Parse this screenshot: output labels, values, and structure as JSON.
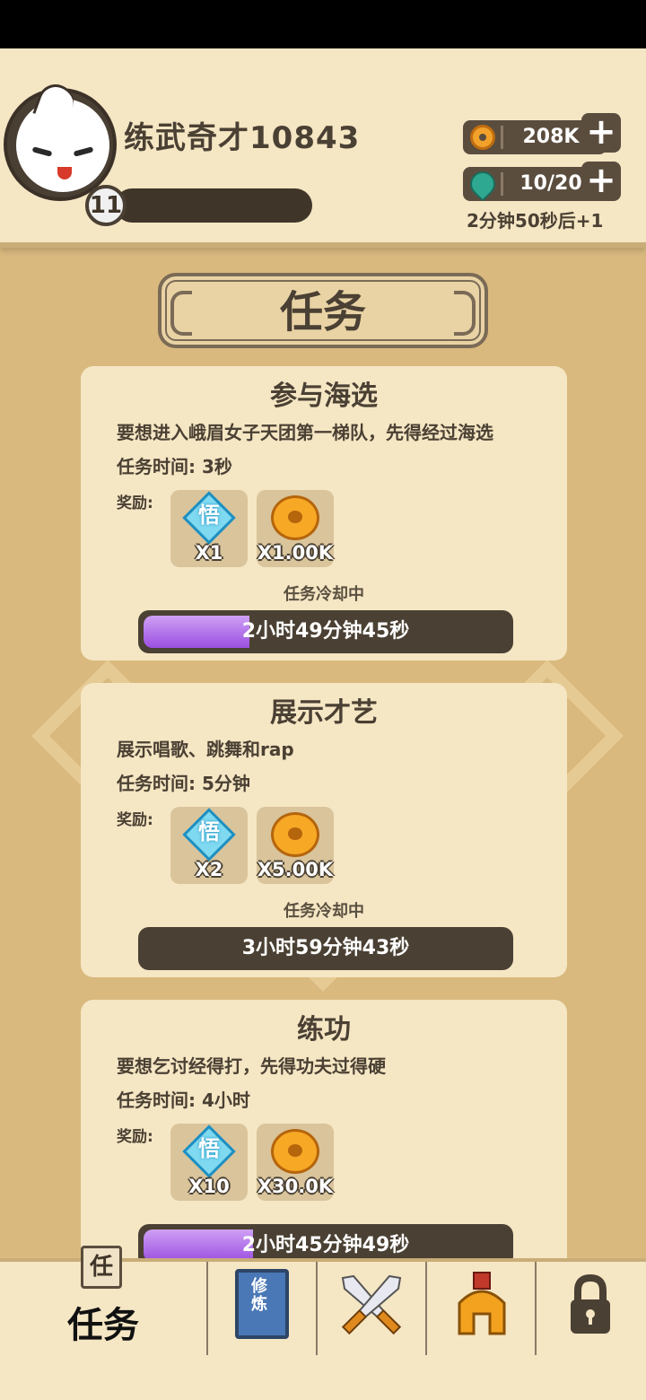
{
  "player": {
    "name": "练武奇才10843",
    "level": "11"
  },
  "resources": {
    "coins": "208K",
    "energy": "10/20",
    "regen_text": "2分钟50秒后+1"
  },
  "page": {
    "title": "任务"
  },
  "tasks": [
    {
      "title": "参与海选",
      "description": "要想进入峨眉女子天团第一梯队，先得经过海选",
      "time": "任务时间: 3秒",
      "reward_label": "奖励:",
      "rewards": [
        {
          "icon": "wu-diamond-icon",
          "char": "悟",
          "count": "X1"
        },
        {
          "icon": "gold-coin-icon",
          "count": "X1.00K"
        }
      ],
      "status": "任务冷却中",
      "timer": "2小时49分钟45秒",
      "progress": 0.29
    },
    {
      "title": "展示才艺",
      "description": "展示唱歌、跳舞和rap",
      "time": "任务时间: 5分钟",
      "reward_label": "奖励:",
      "rewards": [
        {
          "icon": "wu-diamond-icon",
          "char": "悟",
          "count": "X2"
        },
        {
          "icon": "gold-coin-icon",
          "count": "X5.00K"
        }
      ],
      "status": "任务冷却中",
      "timer": "3小时59分钟43秒",
      "progress": 0
    },
    {
      "title": "练功",
      "description": "要想乞讨经得打，先得功夫过得硬",
      "time": "任务时间: 4小时",
      "reward_label": "奖励:",
      "rewards": [
        {
          "icon": "wu-diamond-icon",
          "char": "悟",
          "count": "X10"
        },
        {
          "icon": "gold-coin-icon",
          "count": "X30.0K"
        }
      ],
      "status": "",
      "timer": "2小时45分钟49秒",
      "progress": 0.3
    }
  ],
  "nav": {
    "tasks_label": "任务",
    "tasks_badge": "任",
    "cultivate_book": "修炼",
    "items": [
      "tasks",
      "cultivate",
      "battle",
      "equipment",
      "locked"
    ]
  },
  "colors": {
    "background": "#d9b97e",
    "panel": "#f5e6c4",
    "dark": "#4a4033",
    "progress": "#9b4fe0",
    "coin": "#f7a825",
    "diamond": "#7fd9f0"
  }
}
